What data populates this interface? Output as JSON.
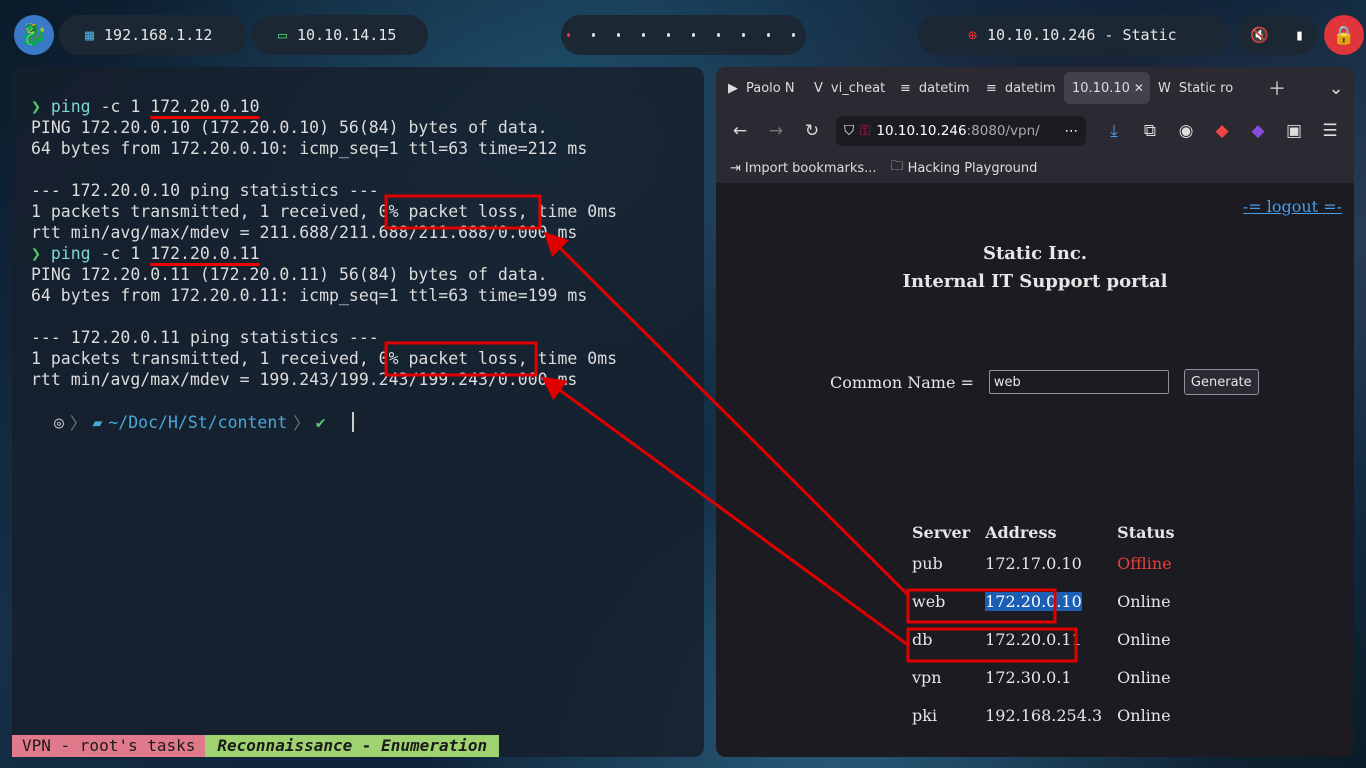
{
  "topbar": {
    "lan_ip": "192.168.1.12",
    "vpn_ip": "10.10.14.15",
    "target": "10.10.10.246 - Static",
    "workspaces": [
      true,
      false,
      false,
      false,
      false,
      false,
      false,
      false,
      false,
      false
    ]
  },
  "terminal": {
    "lines": [
      {
        "type": "cmd",
        "prompt": "❯",
        "cmd": "ping",
        "args": "-c 1",
        "target": "172.20.0.10"
      },
      {
        "type": "out",
        "text": "PING 172.20.0.10 (172.20.0.10) 56(84) bytes of data."
      },
      {
        "type": "out",
        "text": "64 bytes from 172.20.0.10: icmp_seq=1 ttl=63 time=212 ms"
      },
      {
        "type": "out",
        "text": ""
      },
      {
        "type": "out",
        "text": "--- 172.20.0.10 ping statistics ---"
      },
      {
        "type": "out",
        "text": "1 packets transmitted, 1 received, 0% packet loss, time 0ms"
      },
      {
        "type": "out",
        "text": "rtt min/avg/max/mdev = 211.688/211.688/211.688/0.000 ms"
      },
      {
        "type": "cmd",
        "prompt": "❯",
        "cmd": "ping",
        "args": "-c 1",
        "target": "172.20.0.11"
      },
      {
        "type": "out",
        "text": "PING 172.20.0.11 (172.20.0.11) 56(84) bytes of data."
      },
      {
        "type": "out",
        "text": "64 bytes from 172.20.0.11: icmp_seq=1 ttl=63 time=199 ms"
      },
      {
        "type": "out",
        "text": ""
      },
      {
        "type": "out",
        "text": "--- 172.20.0.11 ping statistics ---"
      },
      {
        "type": "out",
        "text": "1 packets transmitted, 1 received, 0% packet loss, time 0ms"
      },
      {
        "type": "out",
        "text": "rtt min/avg/max/mdev = 199.243/199.243/199.243/0.000 ms"
      }
    ],
    "prompt_path_prefix": "~/Doc/H/St/",
    "prompt_path_dir": "content",
    "prompt_check": "✔",
    "status_left": "VPN - root's tasks",
    "status_right": "Reconnaissance - Enumeration"
  },
  "browser": {
    "tabs": [
      {
        "label": "Paolo N",
        "icon": "▶"
      },
      {
        "label": "vi_cheat",
        "icon": "V"
      },
      {
        "label": "datetim",
        "icon": "≡"
      },
      {
        "label": "datetim",
        "icon": "≡"
      },
      {
        "label": "10.10.10",
        "icon": ""
      },
      {
        "label": "Static ro",
        "icon": "W"
      }
    ],
    "url_host": "10.10.10.246",
    "url_rest": ":8080/vpn/",
    "bookmarks": [
      "Import bookmarks...",
      "Hacking Playground"
    ],
    "page": {
      "logout": "-= logout =-",
      "title1": "Static Inc.",
      "title2": "Internal IT Support portal",
      "cn_label": "Common Name =",
      "cn_value": "web",
      "generate": "Generate",
      "headers": [
        "Server",
        "Address",
        "Status"
      ],
      "rows": [
        {
          "server": "pub",
          "address": "172.17.0.10",
          "status": "Offline"
        },
        {
          "server": "web",
          "address": "172.20.0.10",
          "status": "Online"
        },
        {
          "server": "db",
          "address": "172.20.0.11",
          "status": "Online"
        },
        {
          "server": "vpn",
          "address": "172.30.0.1",
          "status": "Online"
        },
        {
          "server": "pki",
          "address": "192.168.254.3",
          "status": "Online"
        }
      ]
    }
  },
  "colors": {
    "annotation_red": "#e00000",
    "link_blue": "#4a9ce8",
    "offline_red": "#e84040",
    "prompt_green": "#4ecb71"
  }
}
